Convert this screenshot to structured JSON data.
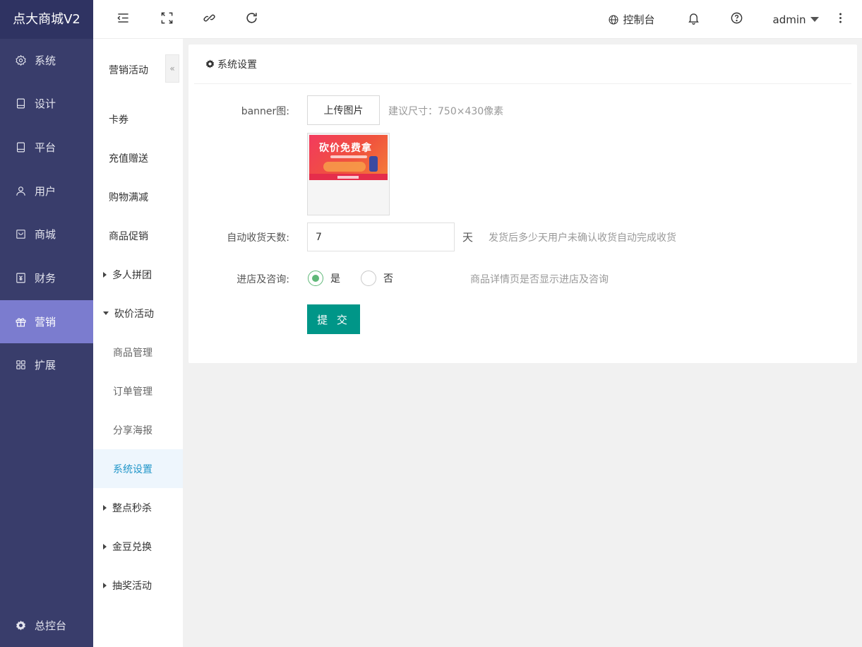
{
  "app": {
    "title": "点大商城V2"
  },
  "sidebar": {
    "items": [
      {
        "label": "系统",
        "icon": "gear-icon"
      },
      {
        "label": "设计",
        "icon": "tablet-icon"
      },
      {
        "label": "平台",
        "icon": "tablet-icon"
      },
      {
        "label": "用户",
        "icon": "user-icon"
      },
      {
        "label": "商城",
        "icon": "shop-icon"
      },
      {
        "label": "财务",
        "icon": "finance-icon"
      },
      {
        "label": "营销",
        "icon": "gift-icon",
        "active": true
      },
      {
        "label": "扩展",
        "icon": "grid-icon"
      }
    ],
    "bottom_label": "总控台"
  },
  "header": {
    "console_label": "控制台",
    "user_label": "admin"
  },
  "subnav": {
    "title": "营销活动",
    "collapse_glyph": "«",
    "items": [
      {
        "label": "卡券"
      },
      {
        "label": "充值赠送"
      },
      {
        "label": "购物满减"
      },
      {
        "label": "商品促销"
      },
      {
        "label": "多人拼团",
        "expandable": true
      },
      {
        "label": "砍价活动",
        "expanded": true
      },
      {
        "label": "商品管理",
        "child": true
      },
      {
        "label": "订单管理",
        "child": true
      },
      {
        "label": "分享海报",
        "child": true
      },
      {
        "label": "系统设置",
        "child": true,
        "active": true
      },
      {
        "label": "整点秒杀",
        "expandable": true
      },
      {
        "label": "金豆兑换",
        "expandable": true
      },
      {
        "label": "抽奖活动",
        "expandable": true
      }
    ]
  },
  "content": {
    "card_title": "系统设置",
    "banner": {
      "label": "banner图:",
      "upload_label": "上传图片",
      "hint": "建议尺寸：750×430像素",
      "image_text": "砍价免费拿"
    },
    "auto_receive": {
      "label": "自动收货天数:",
      "value": "7",
      "unit": "天",
      "hint": "发货后多少天用户未确认收货自动完成收货"
    },
    "store_consult": {
      "label": "进店及咨询:",
      "option_yes": "是",
      "option_no": "否",
      "selected": "是",
      "hint": "商品详情页是否显示进店及咨询"
    },
    "submit_label": "提 交"
  },
  "colors": {
    "sidebar_bg": "#393d6b",
    "sidebar_active": "#7b7ccf",
    "submit_bg": "#009688",
    "radio_checked": "#5fb878",
    "subnav_active_text": "#2196c9"
  }
}
